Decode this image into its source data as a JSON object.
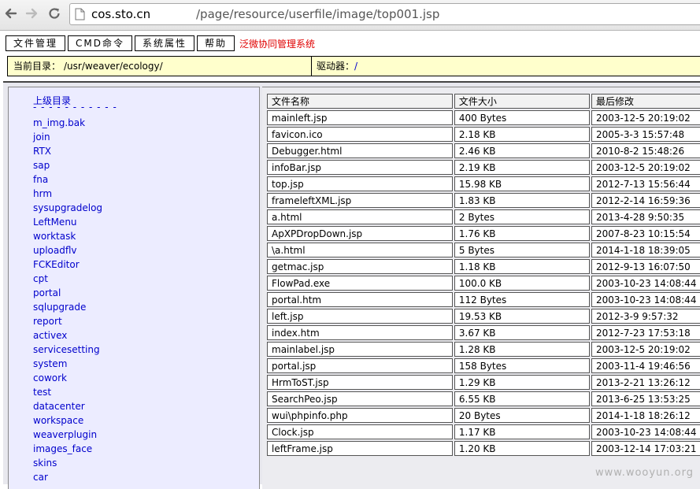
{
  "browser": {
    "url_host": "cos.sto.cn",
    "url_path": "/page/resource/userfile/image/top001.jsp"
  },
  "menu": {
    "items": [
      "文件管理",
      "CMD命令",
      "系统属性",
      "帮助"
    ],
    "title": "泛微协同管理系统"
  },
  "pathbar": {
    "current_dir_label": "当前目录：",
    "current_dir": "/usr/weaver/ecology/",
    "drive_label": "驱动器：",
    "drive_value": "/"
  },
  "dir_tree": {
    "up_label": "上级目录",
    "separator": "- - - - - - - - - - -",
    "items": [
      "m_img.bak",
      "join",
      "RTX",
      "sap",
      "fna",
      "hrm",
      "sysupgradelog",
      "LeftMenu",
      "worktask",
      "uploadflv",
      "FCKEditor",
      "cpt",
      "portal",
      "sqlupgrade",
      "report",
      "activex",
      "servicesetting",
      "system",
      "cowork",
      "test",
      "datacenter",
      "workspace",
      "weaverplugin",
      "images_face",
      "skins",
      "car"
    ]
  },
  "file_table": {
    "headers": [
      "文件名称",
      "文件大小",
      "最后修改"
    ],
    "rows": [
      [
        "mainleft.jsp",
        "400 Bytes",
        "2003-12-5 20:19:02"
      ],
      [
        "favicon.ico",
        "2.18 KB",
        "2005-3-3 15:57:48"
      ],
      [
        "Debugger.html",
        "2.46 KB",
        "2010-8-2 15:48:26"
      ],
      [
        "infoBar.jsp",
        "2.19 KB",
        "2003-12-5 20:19:02"
      ],
      [
        "top.jsp",
        "15.98 KB",
        "2012-7-13 15:56:44"
      ],
      [
        "frameleftXML.jsp",
        "1.83 KB",
        "2012-2-14 16:59:36"
      ],
      [
        "a.html",
        "2 Bytes",
        "2013-4-28 9:50:35"
      ],
      [
        "ApXPDropDown.jsp",
        "1.76 KB",
        "2007-8-23 10:15:54"
      ],
      [
        "\\a.html",
        "5 Bytes",
        "2014-1-18 18:39:05"
      ],
      [
        "getmac.jsp",
        "1.18 KB",
        "2012-9-13 16:07:50"
      ],
      [
        "FlowPad.exe",
        "100.0 KB",
        "2003-10-23 14:08:44"
      ],
      [
        "portal.htm",
        "112 Bytes",
        "2003-10-23 14:08:44"
      ],
      [
        "left.jsp",
        "19.53 KB",
        "2012-3-9 9:57:32"
      ],
      [
        "index.htm",
        "3.67 KB",
        "2012-7-23 17:53:18"
      ],
      [
        "mainlabel.jsp",
        "1.28 KB",
        "2003-12-5 20:19:02"
      ],
      [
        "portal.jsp",
        "158 Bytes",
        "2003-11-4 19:46:56"
      ],
      [
        "HrmToST.jsp",
        "1.29 KB",
        "2013-2-21 13:26:12"
      ],
      [
        "SearchPeo.jsp",
        "6.55 KB",
        "2013-6-25 13:53:25"
      ],
      [
        "wui\\phpinfo.php",
        "20 Bytes",
        "2014-1-18 18:26:12"
      ],
      [
        "Clock.jsp",
        "1.17 KB",
        "2003-10-23 14:08:44"
      ],
      [
        "leftFrame.jsp",
        "1.20 KB",
        "2003-12-14 17:03:21"
      ]
    ]
  },
  "watermark": "www.wooyun.org"
}
